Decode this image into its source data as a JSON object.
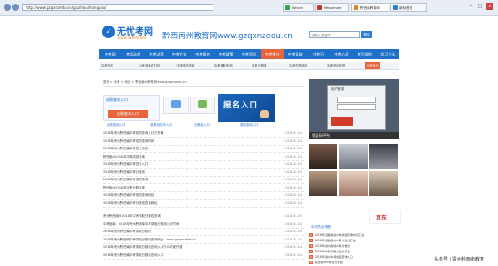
{
  "browser": {
    "address": "http://www.gzqxnzedu.cn/guizhouzhongkao/",
    "tabs": [
      {
        "label": "Weixin",
        "color": "#2aa84a",
        "active": false
      },
      {
        "label": "Messenger",
        "color": "#c0392b",
        "active": false
      },
      {
        "label": "黔西南教育网",
        "color": "#e67e22",
        "active": true
      },
      {
        "label": "新标签页",
        "color": "#2e7fd3",
        "active": false
      }
    ],
    "win_min": "–",
    "win_max": "□",
    "win_close": "×"
  },
  "header": {
    "logo_text": "无忧考网",
    "logo_url": "www.51test.net",
    "site_title": "黔西南州教育网www.gzqxnzedu.cn",
    "search_placeholder": "请输入关键词",
    "search_label": "搜索"
  },
  "main_nav": {
    "items": [
      "中考网",
      "考试动态",
      "中考试题",
      "中考作文",
      "中考报名",
      "中考政策",
      "中考资讯",
      "中考查分",
      "中考录取",
      "中考日",
      "中考心理",
      "考后规划",
      "学习方法"
    ],
    "active_index": 7
  },
  "sub_nav": {
    "items": [
      "中考报名",
      "中考准考证打印",
      "中考成绩查询",
      "中考录取查询",
      "中考分数线",
      "中考志愿填报",
      "中考时间安排",
      "中考查分"
    ],
    "highlight_index": 7
  },
  "breadcrumb": "首页 > 中考 > 地区 > 黔西南州教育网www.gzqxnzedu.cn",
  "banner": {
    "left_label": "成绩查询入口",
    "left_button": "成绩查询入口",
    "right_text": "报名入口"
  },
  "quick_links": [
    "成绩查询入口",
    "准考证打印入口",
    "分数线入口",
    "录取查询入口"
  ],
  "news": [
    {
      "title": "2018年贵州黔西南中考成绩查询入口已开通",
      "date": "2018-05-24"
    },
    {
      "title": "2018年贵州黔西南中考成绩查询时间",
      "date": "2018-05-24"
    },
    {
      "title": "2018年贵州黔西南中考查分系统",
      "date": "2018-05-24"
    },
    {
      "title": "黔西南州2018年中考成绩查询",
      "date": "2018-05-24"
    },
    {
      "title": "2018年贵州黔西南中考查分入口",
      "date": "2018-05-24"
    },
    {
      "title": "2018年贵州黔西南中考分数线",
      "date": "2018-05-24"
    },
    {
      "title": "2018年贵州黔西南中考成绩查询",
      "date": "2018-05-24"
    },
    {
      "title": "黔西南州2018年中考分数查询",
      "date": "2018-05-24"
    },
    {
      "title": "2018年贵州黔西南中考成绩查询网站",
      "date": "2018-05-24"
    },
    {
      "title": "2018年贵州黔西南中考分数线查询网址",
      "date": "2018-05-24"
    },
    {
      "title": "贵州黔西南州2018年中考录取分数线查询",
      "date": "2018-05-24"
    },
    {
      "title": "中考指南：2018年贵州黔西南中考录取分数线公布时间",
      "date": "2018-05-24"
    },
    {
      "title": "2018年贵州黔西南中考录取分数线",
      "date": "2018-05-24"
    },
    {
      "title": "2018年贵州黔西南中考录取分数线查询网址：www.gzqxnzedu.cn",
      "date": "2018-05-24"
    },
    {
      "title": "2018年贵州黔西南中考录取分数线查询入口什么时候开通",
      "date": "2018-05-24"
    },
    {
      "title": "2018年贵州黔西南中考录取分数线查询入口",
      "date": "2018-05-24"
    }
  ],
  "right": {
    "dialog_title": "用户登录",
    "ad_caption": "验证码平台",
    "jd_label": "京东",
    "side_title": "中考热点专题",
    "side_items": [
      "2018年全国各地中考成绩查询时间汇总",
      "2018年全国各地中考分数线汇总",
      "2018年贵州各地中考分数线",
      "2018年中考录取分数线专题",
      "2018年贵州中考成绩查询入口",
      "黔西南州中考查分专题"
    ]
  },
  "watermark": "头条号 / 贵州黔西南教育"
}
